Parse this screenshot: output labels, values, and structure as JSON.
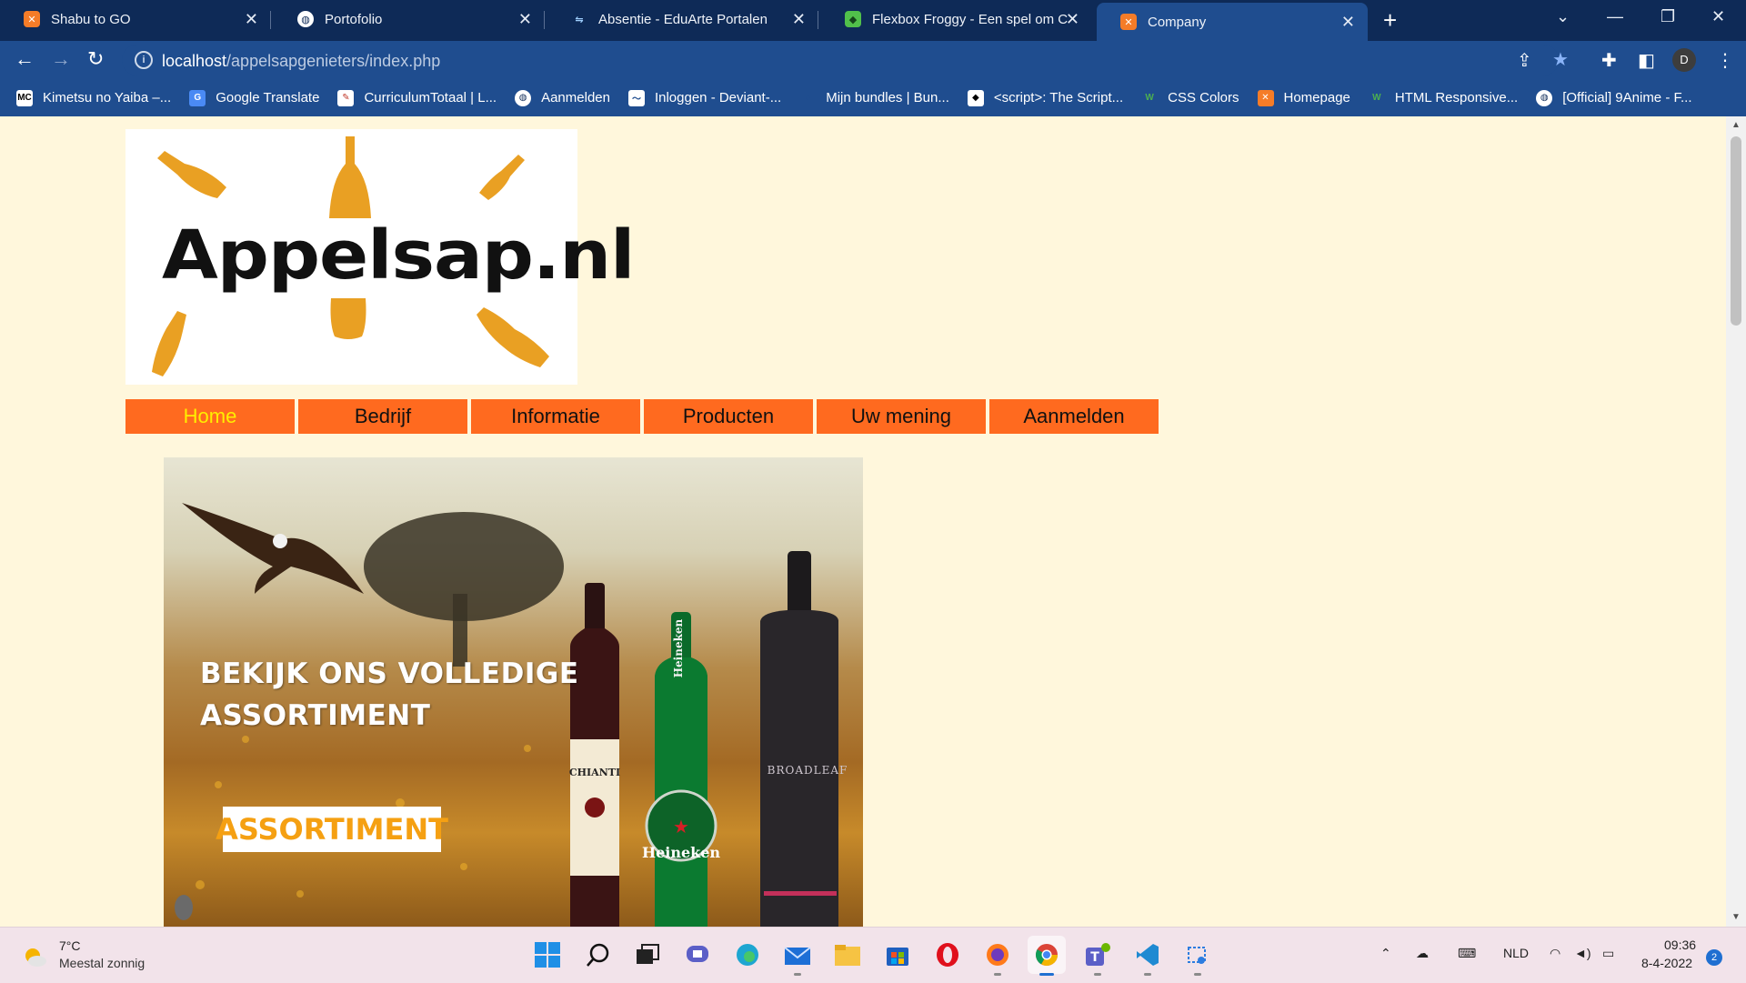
{
  "tabs": [
    {
      "title": "Shabu to GO",
      "favicon": "xampp-icon"
    },
    {
      "title": "Portofolio",
      "favicon": "globe-icon"
    },
    {
      "title": "Absentie - EduArte Portalen",
      "favicon": "eduarte-icon"
    },
    {
      "title": "Flexbox Froggy - Een spel om CS",
      "favicon": "frog-icon"
    },
    {
      "title": "Company",
      "favicon": "xampp-icon",
      "active": true
    }
  ],
  "address_bar": {
    "host": "localhost",
    "path": "/appelsapgenieters/index.php"
  },
  "profile_initial": "D",
  "bookmarks": [
    {
      "label": "Kimetsu no Yaiba –...",
      "icon": "mc-icon"
    },
    {
      "label": "Google Translate",
      "icon": "translate-icon"
    },
    {
      "label": "CurriculumTotaal | L...",
      "icon": "curriculum-icon"
    },
    {
      "label": "Aanmelden",
      "icon": "globe-icon"
    },
    {
      "label": "Inloggen - Deviant-...",
      "icon": "deviant-icon"
    },
    {
      "label": "Mijn bundles | Bun...",
      "icon": "bundle-icon"
    },
    {
      "label": "<script>: The Script...",
      "icon": "script-icon"
    },
    {
      "label": "CSS Colors",
      "icon": "w3-icon"
    },
    {
      "label": "Homepage",
      "icon": "xampp-icon"
    },
    {
      "label": "HTML Responsive...",
      "icon": "w3-icon"
    },
    {
      "label": "[Official] 9Anime - F...",
      "icon": "globe-icon"
    }
  ],
  "page": {
    "logo_text": "Appelsap.nl",
    "menu": [
      {
        "label": "Home",
        "active": true
      },
      {
        "label": "Bedrijf"
      },
      {
        "label": "Informatie"
      },
      {
        "label": "Producten"
      },
      {
        "label": "Uw mening"
      },
      {
        "label": "Aanmelden"
      }
    ],
    "banner": {
      "headline_line1": "BEKIJK ONS VOLLEDIGE",
      "headline_line2": "ASSORTIMENT",
      "button_label": "ASSORTIMENT",
      "bottle_labels": [
        "CHIANTI",
        "Heineken",
        "BROADLEAF"
      ]
    }
  },
  "taskbar": {
    "weather_temp": "7°C",
    "weather_desc": "Meestal zonnig",
    "language": "NLD",
    "time": "09:36",
    "date": "8-4-2022",
    "notification_count": "2"
  },
  "colors": {
    "page_bg": "#fff7dc",
    "menu_bg": "#ff6a1f",
    "menu_active_text": "#ffee00",
    "chrome_dark": "#0e2a57",
    "chrome_light": "#1f4d8f"
  }
}
